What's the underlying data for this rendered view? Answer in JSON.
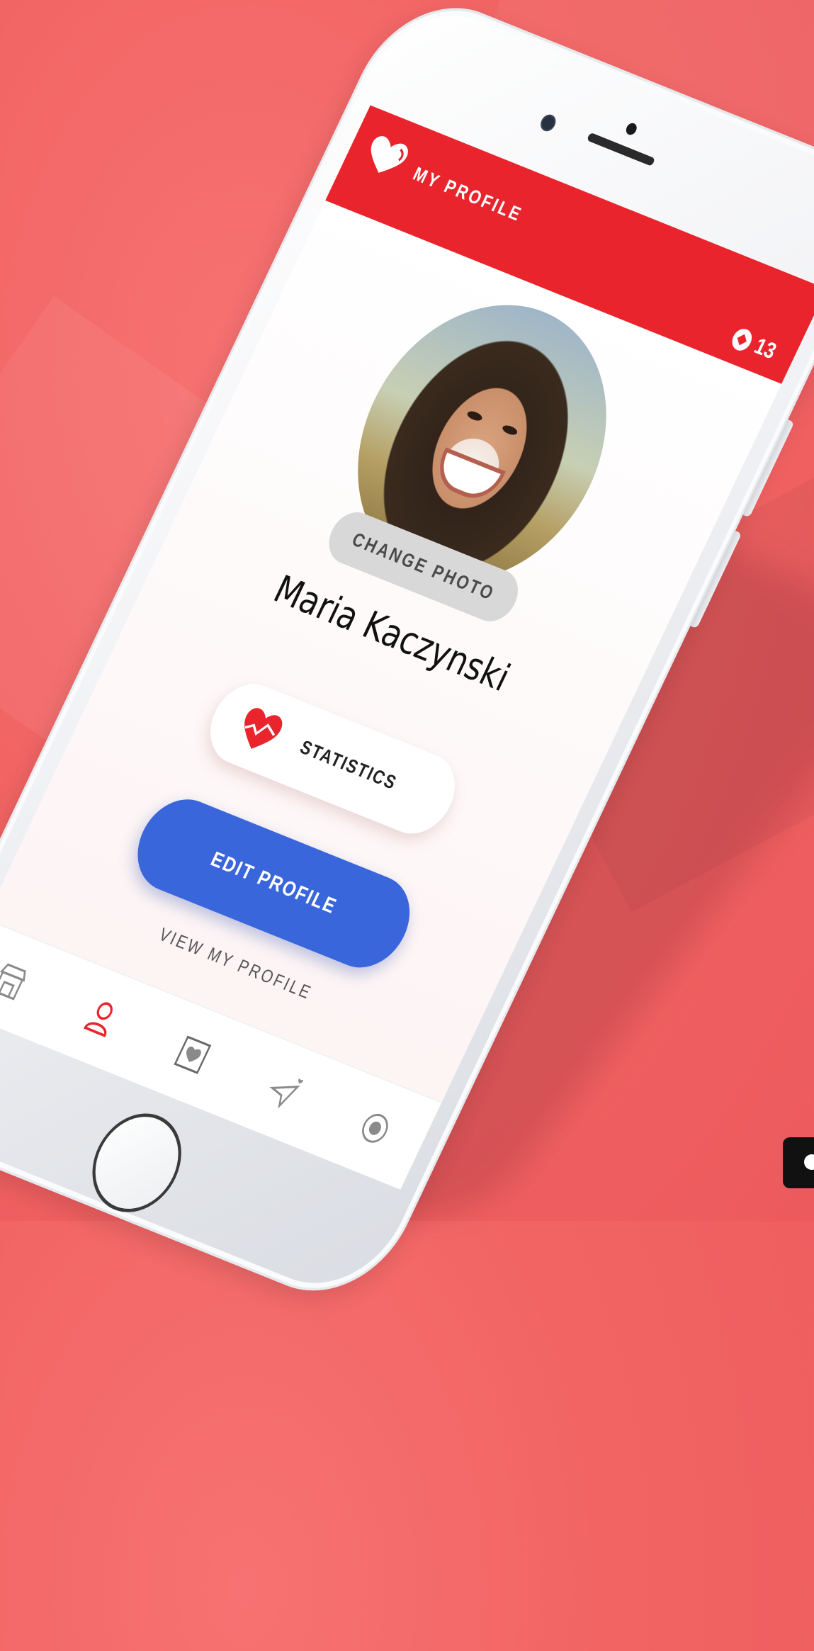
{
  "header": {
    "title": "MY PROFILE",
    "logo_icon": "heart-logo-icon",
    "coins_icon": "coin-icon",
    "coins_count": "13"
  },
  "profile": {
    "avatar": "profile-photo",
    "change_photo_label": "CHANGE PHOTO",
    "name": "Maria Kaczynski"
  },
  "actions": {
    "statistics_label": "STATISTICS",
    "statistics_icon": "heart-chart-icon",
    "edit_label": "EDIT PROFILE",
    "view_label": "VIEW MY PROFILE"
  },
  "tabbar": {
    "items": [
      {
        "icon": "store-icon",
        "active": false
      },
      {
        "icon": "profile-icon",
        "active": true
      },
      {
        "icon": "heart-card-icon",
        "active": false
      },
      {
        "icon": "send-heart-icon",
        "active": false
      },
      {
        "icon": "radio-icon",
        "active": false
      }
    ]
  },
  "colors": {
    "brand_red": "#e9242c",
    "button_blue": "#3a66dc",
    "background": "#f26464"
  }
}
